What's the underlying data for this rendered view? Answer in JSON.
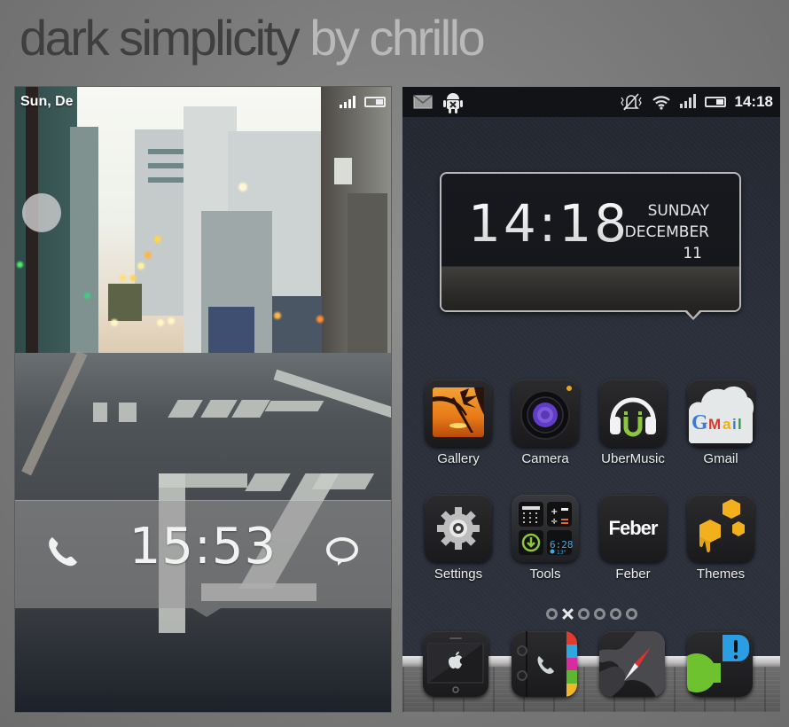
{
  "title": {
    "main": "dark simplicity",
    "author": "by chrillo"
  },
  "lock_screen": {
    "status_date": "Sun, De",
    "time": "15:53",
    "left_shortcut_icon": "phone-icon",
    "right_shortcut_icon": "message-bubble-icon"
  },
  "home_screen": {
    "status_bar": {
      "left_icons": [
        "gmail-notification-icon",
        "android-debug-icon"
      ],
      "right_icons": [
        "silent-mode-icon",
        "wifi-icon",
        "signal-icon",
        "battery-icon"
      ],
      "clock": "14:18"
    },
    "clock_widget": {
      "time": "14:18",
      "weekday": "SUNDAY",
      "month": "DECEMBER",
      "day": "11"
    },
    "apps": [
      {
        "label": "Gallery",
        "icon": "gallery-icon"
      },
      {
        "label": "Camera",
        "icon": "camera-icon"
      },
      {
        "label": "UberMusic",
        "icon": "headphones-icon"
      },
      {
        "label": "Gmail",
        "icon": "gmail-icon"
      },
      {
        "label": "Settings",
        "icon": "gear-icon"
      },
      {
        "label": "Tools",
        "icon": "tools-icon"
      },
      {
        "label": "Feber",
        "icon": "feber-icon"
      },
      {
        "label": "Themes",
        "icon": "honeycomb-icon"
      }
    ],
    "tools_widget": {
      "time": "6:28",
      "temp": "13°"
    },
    "feber_logo": "Feber",
    "page_indicator": {
      "pages": 6,
      "current": 2
    },
    "dock": [
      {
        "icon": "iphone-icon"
      },
      {
        "icon": "phone-book-icon"
      },
      {
        "icon": "browser-compass-icon"
      },
      {
        "icon": "chat-alert-icon"
      }
    ],
    "colors": {
      "background": "#2b303b",
      "status_bar": "#111317",
      "label": "#f0f0f0"
    }
  }
}
